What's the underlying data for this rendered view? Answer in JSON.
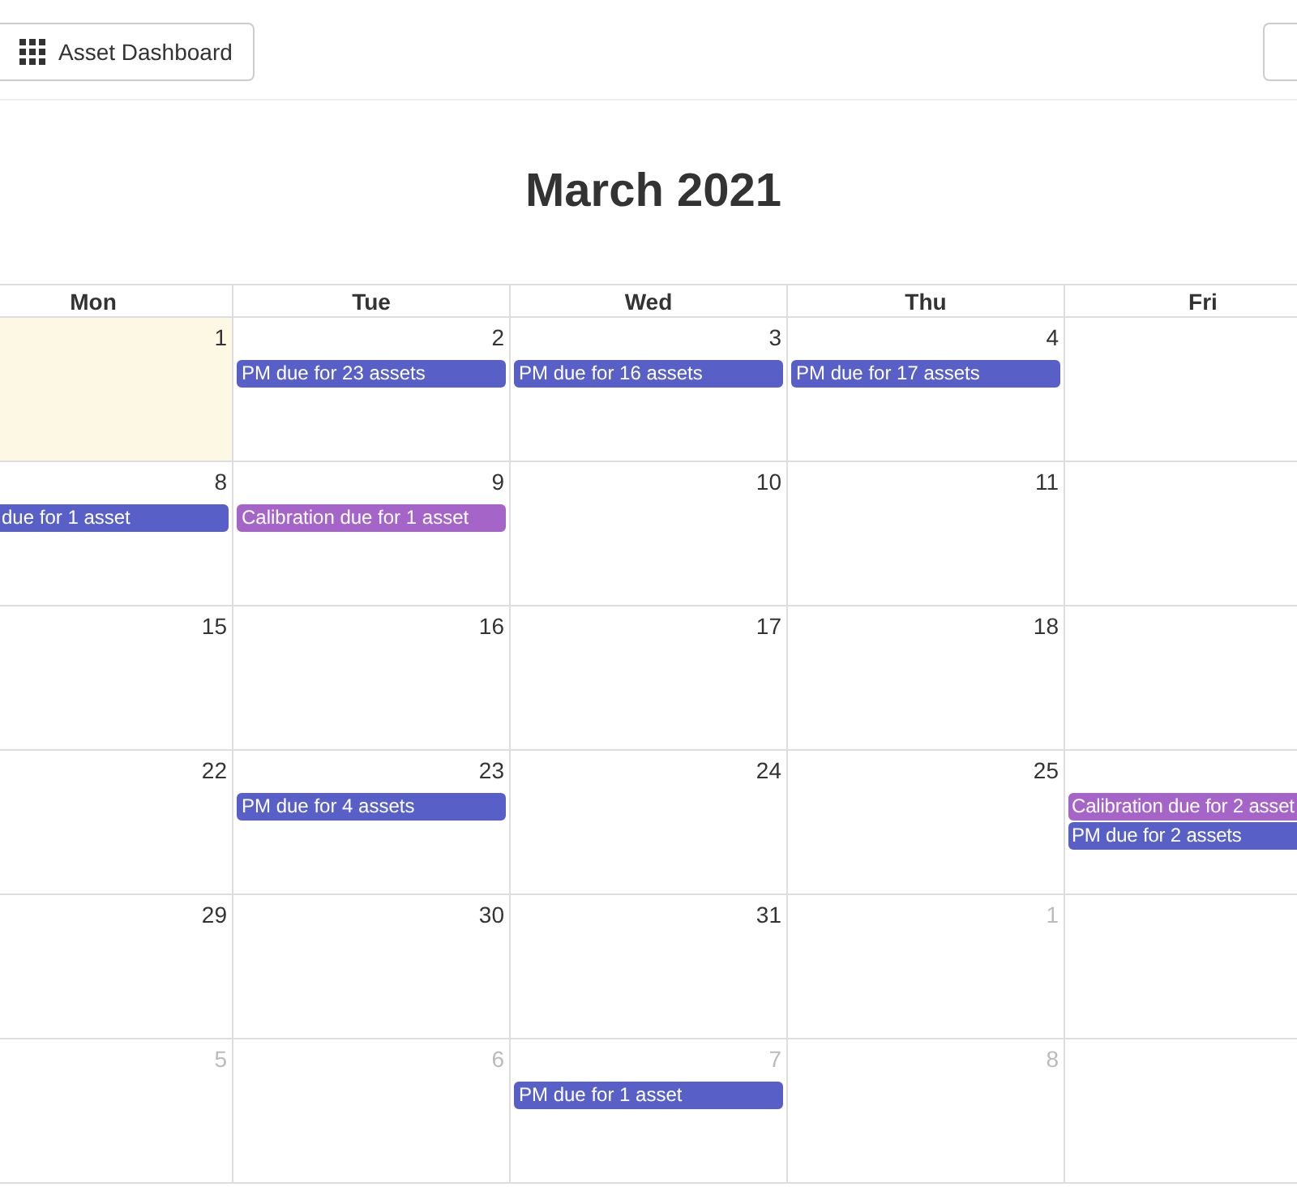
{
  "toolbar": {
    "dashboard_button": {
      "label": "Asset Dashboard"
    }
  },
  "calendar": {
    "title": "March 2021",
    "weekdays": [
      "Mon",
      "Tue",
      "Wed",
      "Thu",
      "Fri"
    ],
    "weeks": [
      [
        {
          "day": "1",
          "today": true,
          "other_month": false
        },
        {
          "day": "2",
          "today": false,
          "other_month": false,
          "events": [
            {
              "label": "PM due for 23 assets",
              "color": "#5860c7"
            }
          ]
        },
        {
          "day": "3",
          "today": false,
          "other_month": false,
          "events": [
            {
              "label": "PM due for 16 assets",
              "color": "#5860c7"
            }
          ]
        },
        {
          "day": "4",
          "today": false,
          "other_month": false,
          "events": [
            {
              "label": "PM due for 17 assets",
              "color": "#5860c7"
            }
          ]
        },
        {
          "today": false
        }
      ],
      [
        {
          "day": "8",
          "today": false,
          "other_month": false,
          "events": [
            {
              "label": "due for 1 asset",
              "color": "#5860c7"
            }
          ]
        },
        {
          "day": "9",
          "today": false,
          "other_month": false,
          "events": [
            {
              "label": "Calibration due for 1 asset",
              "color": "#a564c8"
            }
          ]
        },
        {
          "day": "10",
          "today": false,
          "other_month": false
        },
        {
          "day": "11",
          "today": false,
          "other_month": false
        },
        {
          "today": false
        }
      ],
      [
        {
          "day": "15",
          "today": false,
          "other_month": false
        },
        {
          "day": "16",
          "today": false,
          "other_month": false
        },
        {
          "day": "17",
          "today": false,
          "other_month": false
        },
        {
          "day": "18",
          "today": false,
          "other_month": false
        },
        {
          "today": false
        }
      ],
      [
        {
          "day": "22",
          "today": false,
          "other_month": false
        },
        {
          "day": "23",
          "today": false,
          "other_month": false,
          "events": [
            {
              "label": "PM due for 4 assets",
              "color": "#5860c7"
            }
          ]
        },
        {
          "day": "24",
          "today": false,
          "other_month": false
        },
        {
          "day": "25",
          "today": false,
          "other_month": false
        },
        {
          "today": false,
          "events": [
            {
              "label": "Calibration due for 2 asset",
              "color": "#a564c8"
            },
            {
              "label": "PM due for 2 assets",
              "color": "#5860c7"
            }
          ]
        }
      ],
      [
        {
          "day": "29",
          "today": false,
          "other_month": false
        },
        {
          "day": "30",
          "today": false,
          "other_month": false
        },
        {
          "day": "31",
          "today": false,
          "other_month": false
        },
        {
          "day": "1",
          "today": false,
          "other_month": true
        },
        {
          "today": false
        }
      ],
      [
        {
          "day": "5",
          "today": false,
          "other_month": true
        },
        {
          "day": "6",
          "today": false,
          "other_month": true
        },
        {
          "day": "7",
          "today": false,
          "other_month": true,
          "events": [
            {
              "label": "PM due for 1 asset",
              "color": "#5860c7"
            }
          ]
        },
        {
          "day": "8",
          "today": false,
          "other_month": true
        },
        {
          "today": false
        }
      ]
    ]
  }
}
